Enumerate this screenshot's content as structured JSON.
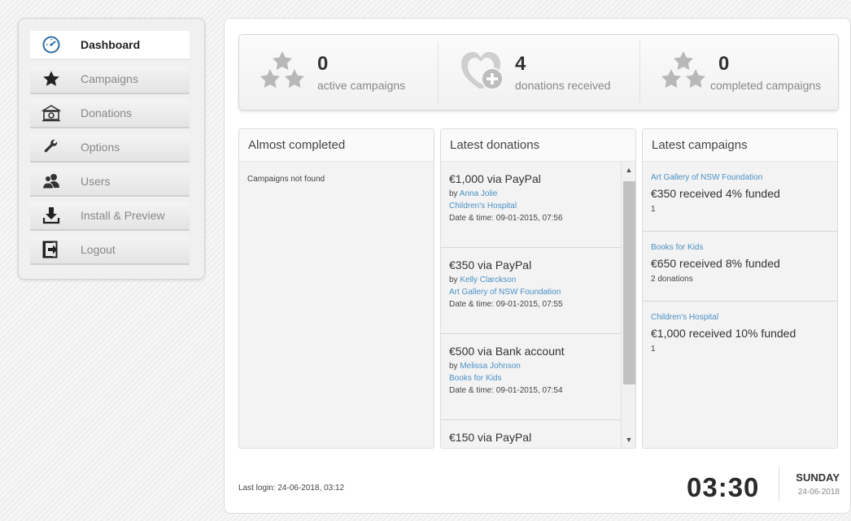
{
  "sidebar": {
    "items": [
      {
        "label": "Dashboard",
        "icon": "gauge-icon",
        "active": true
      },
      {
        "label": "Campaigns",
        "icon": "star-icon"
      },
      {
        "label": "Donations",
        "icon": "money-icon"
      },
      {
        "label": "Options",
        "icon": "wrench-icon"
      },
      {
        "label": "Users",
        "icon": "users-icon"
      },
      {
        "label": "Install & Preview",
        "icon": "download-icon"
      },
      {
        "label": "Logout",
        "icon": "logout-icon"
      }
    ]
  },
  "stats": {
    "active": {
      "count": "0",
      "label": "active campaigns"
    },
    "donations": {
      "count": "4",
      "label": "donations received"
    },
    "completed": {
      "count": "0",
      "label": "completed campaigns"
    }
  },
  "almost_completed": {
    "title": "Almost completed",
    "empty_text": "Campaigns not found"
  },
  "latest_donations": {
    "title": "Latest donations",
    "items": [
      {
        "amount": "€1,000 via PayPal",
        "by_prefix": "by ",
        "donor": "Anna Jolie",
        "campaign": "Children's Hospital",
        "date": "Date & time: 09-01-2015, 07:56"
      },
      {
        "amount": "€350 via PayPal",
        "by_prefix": "by ",
        "donor": "Kelly Clarckson",
        "campaign": "Art Gallery of NSW Foundation",
        "date": "Date & time: 09-01-2015, 07:55"
      },
      {
        "amount": "€500 via Bank account",
        "by_prefix": "by ",
        "donor": "Melissa Johnson",
        "campaign": "Books for Kids",
        "date": "Date & time: 09-01-2015, 07:54"
      },
      {
        "amount": "€150 via PayPal",
        "by_prefix": "",
        "donor": "",
        "campaign": "",
        "date": ""
      }
    ]
  },
  "latest_campaigns": {
    "title": "Latest campaigns",
    "items": [
      {
        "name": "Art Gallery of NSW Foundation",
        "status": "€350 received 4% funded",
        "count": "1"
      },
      {
        "name": "Books for Kids",
        "status": "€650 received 8% funded",
        "count": "2 donations"
      },
      {
        "name": "Children's Hospital",
        "status": "€1,000 received 10% funded",
        "count": "1"
      }
    ]
  },
  "footer": {
    "last_login": "Last login: 24-06-2018, 03:12",
    "time": "03:30",
    "day": "SUNDAY",
    "date": "24-06-2018"
  },
  "colors": {
    "link": "#4a90c4",
    "gauge": "#2c6fa6"
  }
}
